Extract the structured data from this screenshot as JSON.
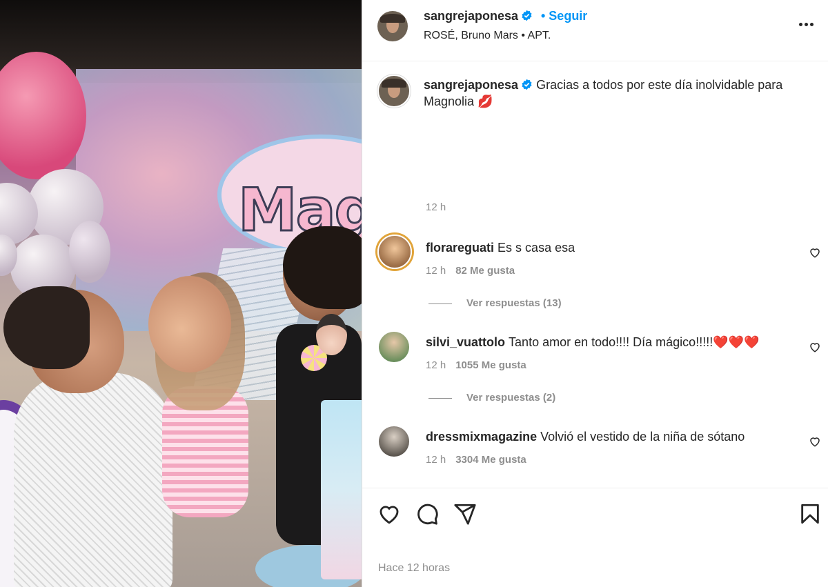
{
  "post": {
    "author": "sangrejaponesa",
    "follow_label": "Seguir",
    "audio": "ROSÉ, Bruno Mars • APT.",
    "caption_text": "Gracias a todos por este día inolvidable para Magnolia",
    "caption_emoji": "💋",
    "caption_time": "12 h",
    "timestamp": "Hace 12 horas",
    "media_sign_text": "Mag"
  },
  "comments": [
    {
      "user": "florareguati",
      "text": "Es s casa esa",
      "time": "12 h",
      "likes": "82 Me gusta",
      "replies": "Ver respuestas (13)"
    },
    {
      "user": "silvi_vuattolo",
      "text": "Tanto amor en todo!!!! Día mágico!!!!!",
      "emoji": "❤️❤️❤️",
      "time": "12 h",
      "likes": "1055 Me gusta",
      "replies": "Ver respuestas (2)"
    },
    {
      "user": "dressmixmagazine",
      "text": "Volvió el vestido de la niña de sótano",
      "time": "12 h",
      "likes": "3304 Me gusta"
    }
  ],
  "icons": {
    "verified": "verified-badge-icon",
    "more": "more-options-icon",
    "heart": "heart-icon",
    "comment": "comment-icon",
    "share": "share-icon",
    "save": "bookmark-icon"
  },
  "colors": {
    "accent": "#0095f6",
    "text": "#262626",
    "muted": "#8e8e8e"
  }
}
